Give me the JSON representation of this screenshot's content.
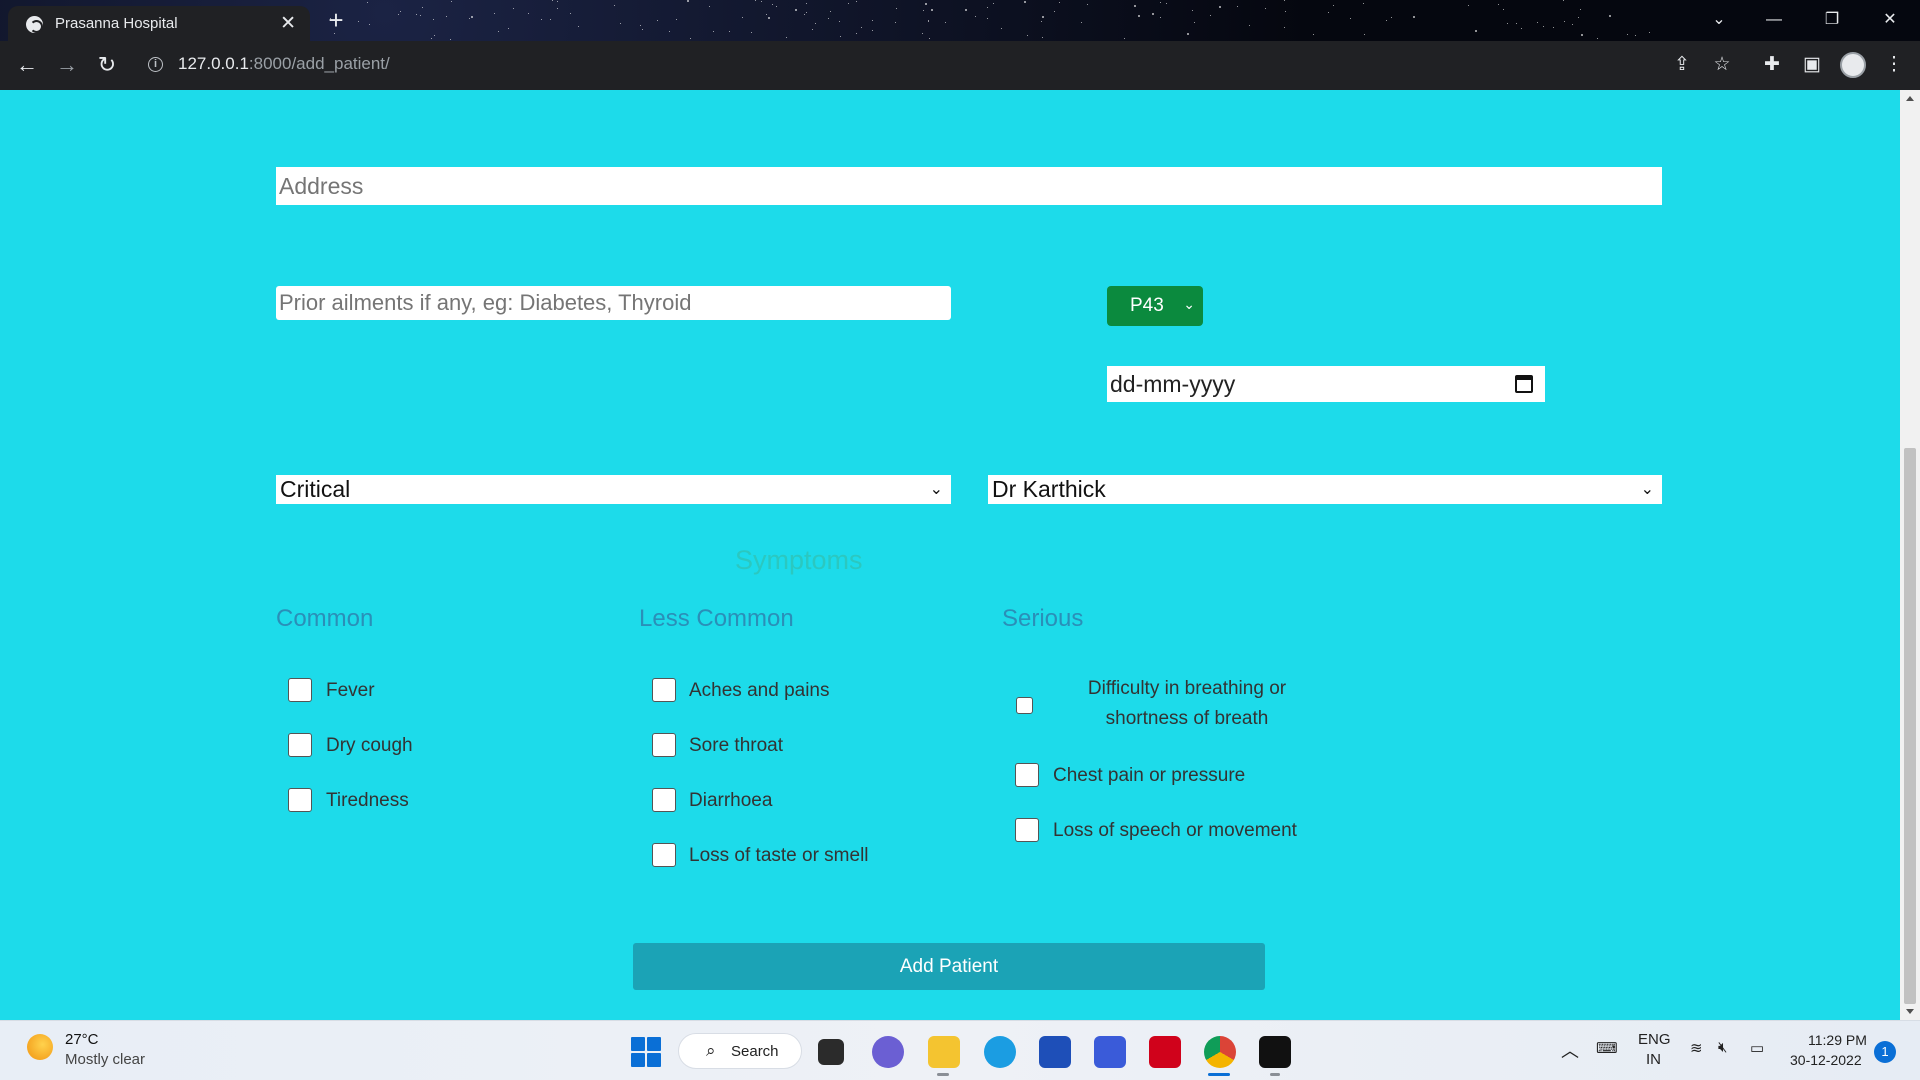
{
  "browser": {
    "tab_title": "Prasanna Hospital",
    "tab_close": "✕",
    "new_tab": "+",
    "url_host": "127.0.0.1",
    "url_rest": ":8000/add_patient/"
  },
  "form": {
    "address_placeholder": "Address",
    "prior_ailments_placeholder": "Prior ailments if any, eg: Diabetes, Thyroid",
    "patient_id": "P43",
    "date_placeholder": "dd-mm-yyyy",
    "priority": "Critical",
    "doctor": "Dr Karthick",
    "symptoms_title": "Symptoms",
    "columns": {
      "common": {
        "heading": "Common",
        "items": [
          "Fever",
          "Dry cough",
          "Tiredness"
        ]
      },
      "less_common": {
        "heading": "Less Common",
        "items": [
          "Aches and pains",
          "Sore throat",
          "Diarrhoea",
          "Loss of taste or smell"
        ]
      },
      "serious": {
        "heading": "Serious",
        "items": [
          "Difficulty in breathing or shortness of breath",
          "Chest pain or pressure",
          "Loss of speech or movement"
        ]
      }
    },
    "submit_label": "Add Patient"
  },
  "taskbar": {
    "weather_temp": "27°C",
    "weather_desc": "Mostly clear",
    "search_label": "Search",
    "lang_1": "ENG",
    "lang_2": "IN",
    "time": "11:29 PM",
    "date": "30-12-2022",
    "notifications": "1"
  },
  "colors": {
    "page_bg": "#1ddbea",
    "button_bg": "#1ba3b6",
    "patient_id_bg": "#0b8a3e"
  }
}
